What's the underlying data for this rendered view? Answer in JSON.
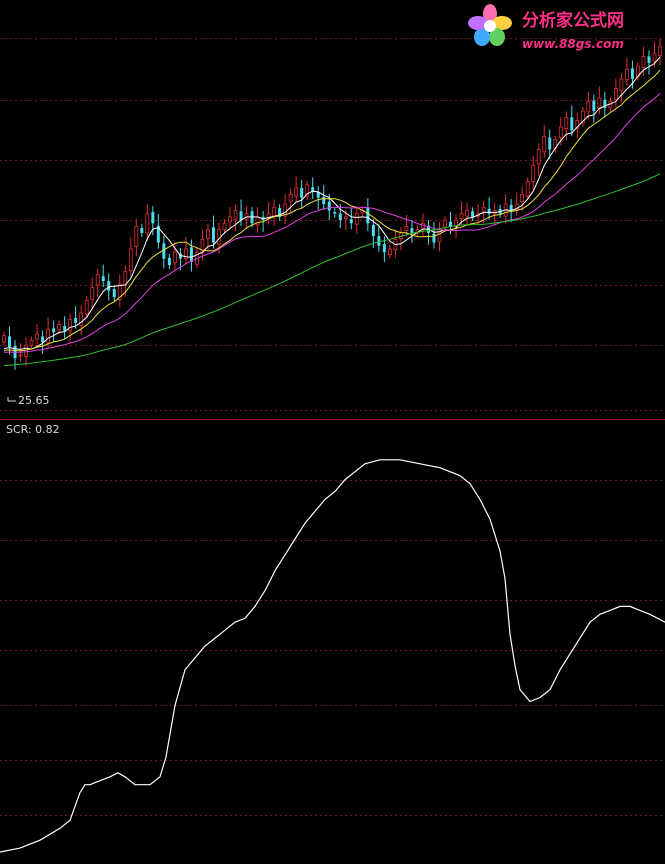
{
  "watermark": {
    "title": "分析家公式网",
    "url": "www.88gs.com",
    "icon": "flower-logo-icon"
  },
  "colors": {
    "background": "#000000",
    "grid": "#7a1a1a",
    "divider": "#b01010",
    "up_candle": "#e03030",
    "down_candle": "#50dcf0",
    "ma_fast": "#ffffff",
    "ma_mid": "#f0e040",
    "ma_slow": "#e040e0",
    "ma_long": "#30c030",
    "indicator": "#ffffff"
  },
  "chart_data": [
    {
      "type": "candlestick",
      "panel": "price",
      "low_label": "25.65",
      "ylim": [
        24.5,
        46.5
      ],
      "x": [
        0,
        130
      ],
      "closes": [
        28.2,
        27.5,
        26.8,
        27.0,
        27.6,
        27.9,
        28.3,
        27.8,
        28.6,
        28.4,
        28.9,
        28.5,
        29.2,
        29.0,
        29.6,
        30.4,
        31.2,
        32.0,
        31.6,
        31.0,
        30.6,
        31.4,
        32.2,
        33.6,
        35.0,
        34.6,
        35.8,
        35.2,
        34.0,
        33.0,
        32.6,
        33.4,
        33.0,
        33.6,
        32.8,
        33.4,
        34.2,
        34.8,
        34.0,
        34.8,
        35.2,
        35.6,
        36.0,
        35.4,
        35.8,
        35.2,
        35.6,
        35.4,
        35.8,
        36.2,
        35.6,
        36.4,
        37.0,
        37.4,
        36.8,
        37.6,
        37.2,
        36.8,
        36.4,
        36.0,
        35.8,
        35.4,
        35.6,
        35.2,
        35.8,
        36.0,
        35.2,
        34.4,
        33.8,
        33.4,
        33.6,
        34.2,
        34.6,
        35.0,
        34.6,
        34.8,
        35.2,
        34.6,
        34.0,
        34.8,
        35.4,
        35.0,
        35.4,
        35.8,
        36.0,
        35.6,
        35.8,
        36.2,
        35.8,
        36.0,
        35.8,
        36.4,
        36.0,
        36.4,
        37.0,
        37.8,
        38.8,
        39.8,
        40.6,
        39.8,
        40.4,
        41.2,
        41.8,
        41.0,
        41.6,
        42.2,
        42.8,
        42.2,
        43.0,
        42.4,
        42.8,
        43.6,
        44.2,
        44.8,
        44.2,
        45.0,
        45.6,
        45.2,
        45.8,
        46.2
      ],
      "series": [
        {
          "type": "line",
          "period": 5,
          "color": "#ffffff"
        },
        {
          "type": "line",
          "period": 10,
          "color": "#f0e040"
        },
        {
          "type": "line",
          "period": 20,
          "color": "#e040e0"
        },
        {
          "type": "line",
          "period": 60,
          "color": "#30c030"
        }
      ]
    },
    {
      "type": "line",
      "panel": "indicator",
      "title": "SCR: 0.82",
      "ylim": [
        0,
        1.05
      ],
      "x": [
        0,
        20,
        40,
        60,
        70,
        80,
        85,
        90,
        100,
        110,
        118,
        125,
        135,
        145,
        150,
        160,
        166,
        175,
        185,
        195,
        205,
        215,
        225,
        235,
        245,
        255,
        265,
        275,
        285,
        295,
        305,
        315,
        325,
        335,
        345,
        355,
        365,
        380,
        400,
        420,
        440,
        460,
        470,
        480,
        490,
        500,
        505,
        510,
        515,
        520,
        530,
        540,
        550,
        560,
        570,
        580,
        590,
        600,
        610,
        620,
        630,
        640,
        650,
        665
      ],
      "values": [
        0.01,
        0.02,
        0.04,
        0.07,
        0.09,
        0.16,
        0.18,
        0.18,
        0.19,
        0.2,
        0.21,
        0.2,
        0.18,
        0.18,
        0.18,
        0.2,
        0.25,
        0.38,
        0.47,
        0.5,
        0.53,
        0.55,
        0.57,
        0.59,
        0.6,
        0.63,
        0.67,
        0.72,
        0.76,
        0.8,
        0.84,
        0.87,
        0.9,
        0.92,
        0.95,
        0.97,
        0.99,
        1.0,
        1.0,
        0.99,
        0.98,
        0.96,
        0.94,
        0.9,
        0.85,
        0.77,
        0.7,
        0.56,
        0.48,
        0.42,
        0.39,
        0.4,
        0.42,
        0.47,
        0.51,
        0.55,
        0.59,
        0.61,
        0.62,
        0.63,
        0.63,
        0.62,
        0.61,
        0.59
      ]
    }
  ]
}
